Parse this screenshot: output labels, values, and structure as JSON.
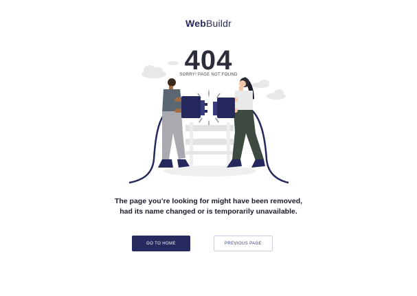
{
  "brand": {
    "name_bold": "Web",
    "name_regular": "Buildr"
  },
  "error": {
    "code": "404",
    "subtitle": "SORRY! PAGE NOT FOUND"
  },
  "message": {
    "line1": "The page you’re looking for might have been removed,",
    "line2": "had its name changed or is temporarily unavailable."
  },
  "buttons": {
    "home_label": "GO TO HOME",
    "previous_label": "PREVIOUS PAGE"
  },
  "colors": {
    "primary": "#272a5e",
    "accent": "#3c3f87",
    "text": "#1b1c2a"
  },
  "illustration": "two-people-unplugged-cable"
}
